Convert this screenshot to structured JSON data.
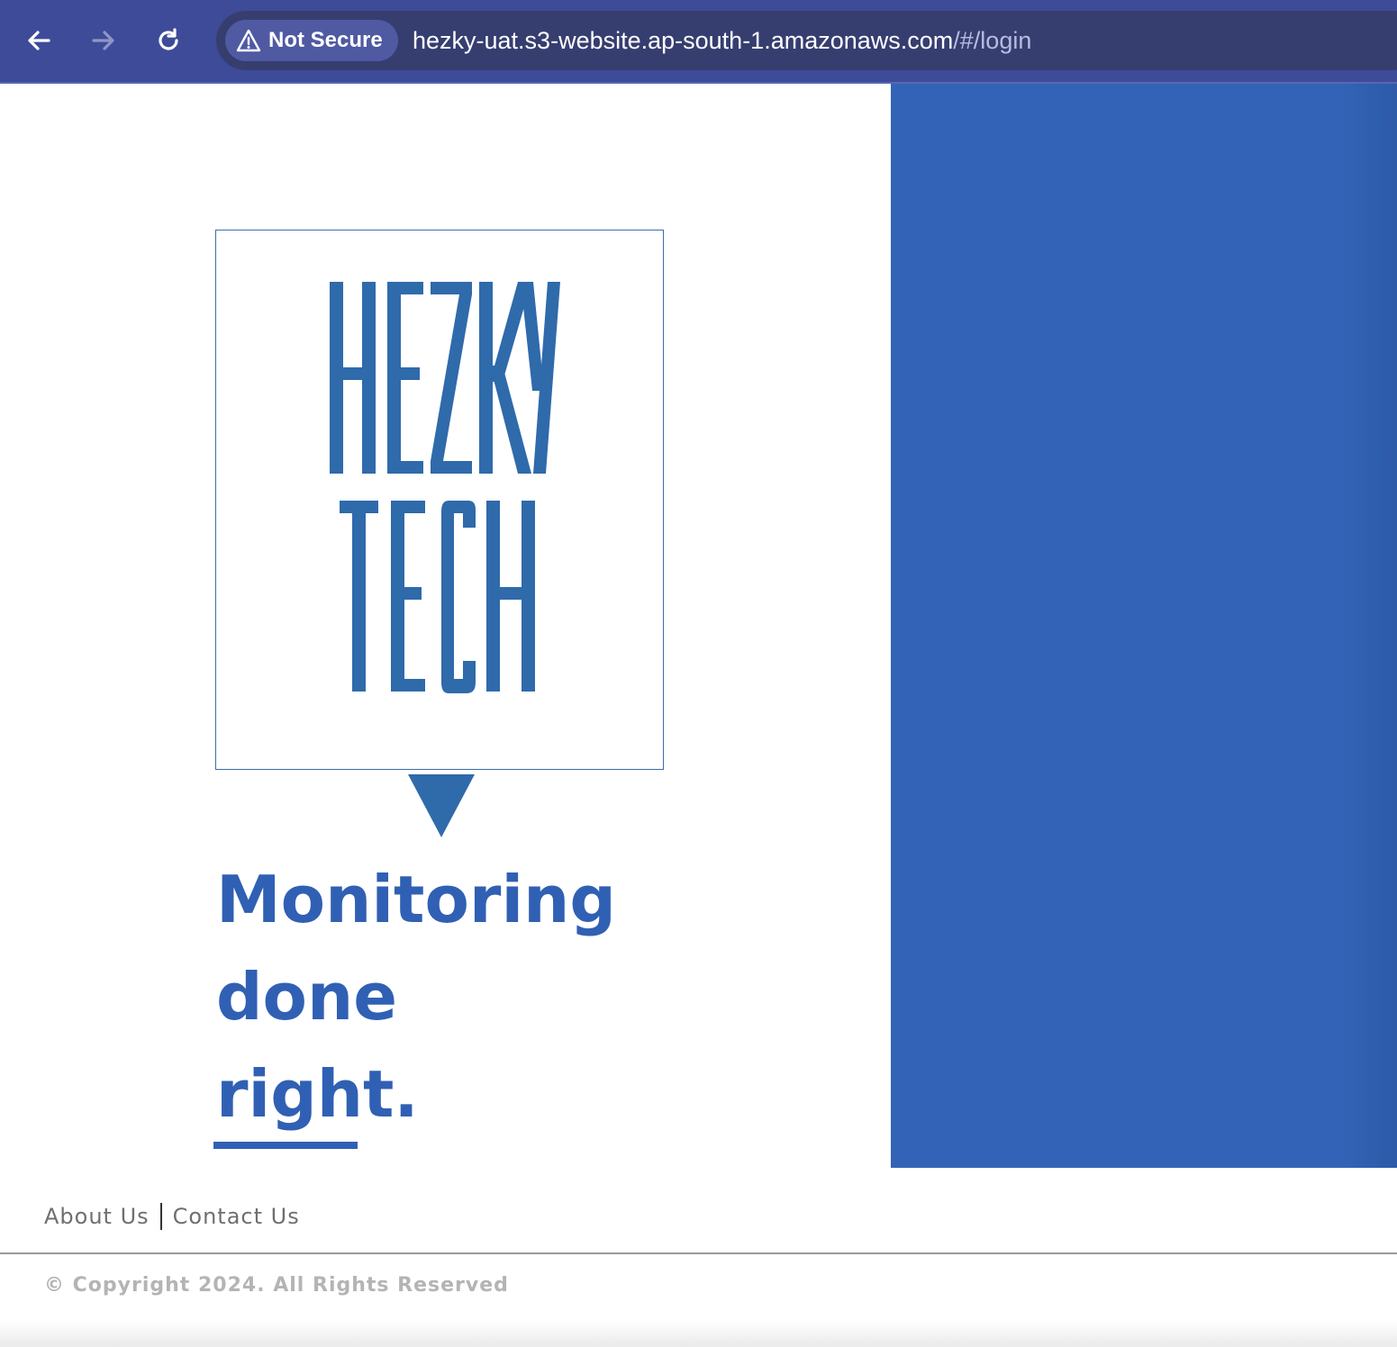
{
  "browser": {
    "security_label": "Not Secure",
    "url_host": "hezky-uat.s3-website.ap-south-1.amazonaws.com",
    "url_path": "/#/login",
    "icons": [
      "back-arrow-icon",
      "forward-arrow-icon",
      "reload-icon",
      "warning-icon"
    ]
  },
  "brand": {
    "logo_line1": "HEZKY",
    "logo_line2": "TECH",
    "logo_color": "#2f6aab"
  },
  "hero": {
    "tagline_line1": "Monitoring",
    "tagline_line2": "done",
    "tagline_line3": "right.",
    "accent_color": "#3060b4",
    "panel_color": "#3263b6"
  },
  "footer": {
    "about_label": "About Us",
    "contact_label": "Contact Us",
    "copyright": "© Copyright 2024. All Rights Reserved"
  }
}
